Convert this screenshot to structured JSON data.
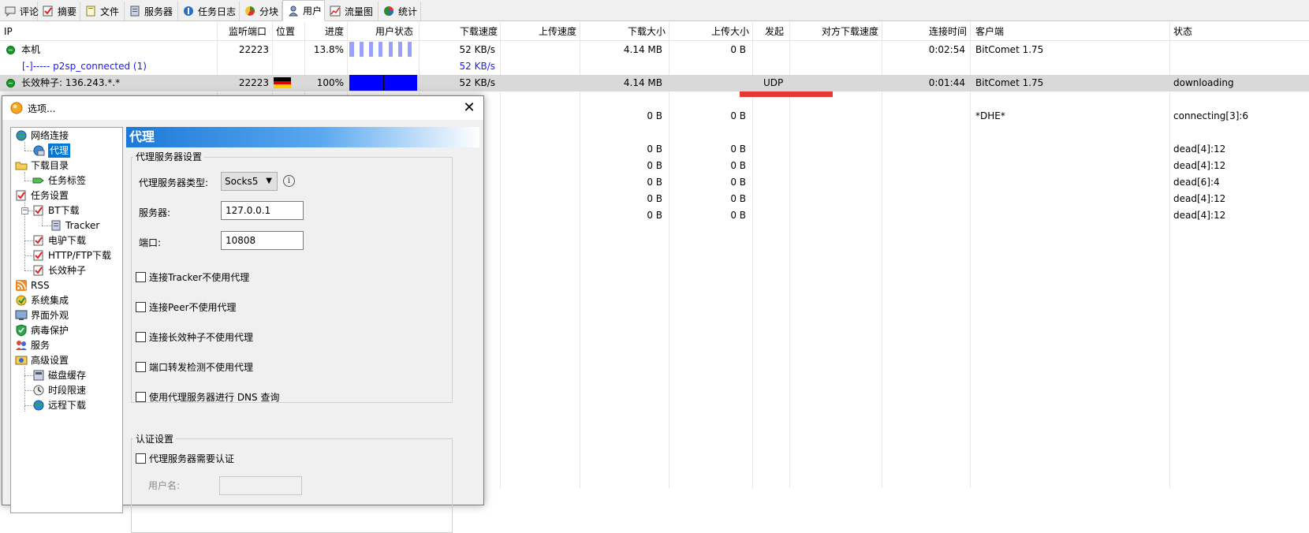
{
  "tabs": [
    {
      "label": "评论",
      "icon": "comment-icon"
    },
    {
      "label": "摘要",
      "icon": "summary-icon"
    },
    {
      "label": "文件",
      "icon": "files-icon"
    },
    {
      "label": "服务器",
      "icon": "server-icon"
    },
    {
      "label": "任务日志",
      "icon": "log-icon"
    },
    {
      "label": "分块",
      "icon": "pieces-icon"
    },
    {
      "label": "用户",
      "icon": "user-icon",
      "active": true
    },
    {
      "label": "流量图",
      "icon": "traffic-chart-icon"
    },
    {
      "label": "统计",
      "icon": "statistics-icon"
    }
  ],
  "columns": [
    "IP",
    "监听端口",
    "位置",
    "进度",
    "用户状态",
    "下载速度",
    "上传速度",
    "下载大小",
    "上传大小",
    "发起",
    "对方下载速度",
    "连接时间",
    "客户端",
    "状态"
  ],
  "rows": {
    "local": {
      "ip": "本机",
      "port": "22223",
      "progress": "13.8%",
      "progress_fraction": 0.138,
      "down_speed": "52 KB/s",
      "down_size": "4.14 MB",
      "up_size": "0 B",
      "conn_time": "0:02:54",
      "client": "BitComet 1.75"
    },
    "group": {
      "label": "[-]----- p2sp_connected (1)",
      "down_speed": "52 KB/s"
    },
    "seed": {
      "ip": "长效种子: 136.243.*.*",
      "port": "22223",
      "progress": "100%",
      "progress_fraction": 1.0,
      "down_speed": "52 KB/s",
      "down_size": "4.14 MB",
      "initiator": "UDP",
      "conn_time": "0:01:44",
      "client": "BitComet 1.75",
      "status": "downloading"
    },
    "r1": {
      "down_size": "0 B",
      "up_size": "0 B",
      "client": "*DHE*",
      "status": "connecting[3]:6"
    },
    "r2": {
      "down_size": "0 B",
      "up_size": "0 B",
      "status": "dead[4]:12"
    },
    "r3": {
      "down_size": "0 B",
      "up_size": "0 B",
      "status": "dead[4]:12"
    },
    "r4": {
      "down_size": "0 B",
      "up_size": "0 B",
      "status": "dead[6]:4"
    },
    "r5": {
      "down_size": "0 B",
      "up_size": "0 B",
      "status": "dead[4]:12"
    },
    "r6": {
      "down_size": "0 B",
      "up_size": "0 B",
      "status": "dead[4]:12"
    }
  },
  "dialog": {
    "title": "选项...",
    "close": "✕",
    "tree": {
      "network": "网络连接",
      "proxy": "代理",
      "download_dir": "下载目录",
      "task_tags": "任务标签",
      "task_settings": "任务设置",
      "bt": "BT下载",
      "tracker": "Tracker",
      "ed2k": "电驴下载",
      "http_ftp": "HTTP/FTP下载",
      "long_seed": "长效种子",
      "rss": "RSS",
      "system": "系统集成",
      "appearance": "界面外观",
      "antivirus": "病毒保护",
      "service": "服务",
      "advanced": "高级设置",
      "disk_cache": "磁盘缓存",
      "schedule": "时段限速",
      "remote": "远程下载"
    },
    "panel": {
      "title": "代理",
      "proxy_group": "代理服务器设置",
      "type_label": "代理服务器类型:",
      "type_value": "Socks5",
      "server_label": "服务器:",
      "server_value": "127.0.0.1",
      "port_label": "端口:",
      "port_value": "10808",
      "checks": [
        "连接Tracker不使用代理",
        "连接Peer不使用代理",
        "连接长效种子不使用代理",
        "端口转发检测不使用代理",
        "使用代理服务器进行 DNS 查询"
      ],
      "auth_group": "认证设置",
      "auth_check": "代理服务器需要认证",
      "username_label": "用户名:"
    }
  },
  "colors": {
    "progress_blue": "#0000ff",
    "highlight_row": "#d9d9d9",
    "initiator_bar": "#e53935",
    "link_blue": "#1a1aff"
  }
}
